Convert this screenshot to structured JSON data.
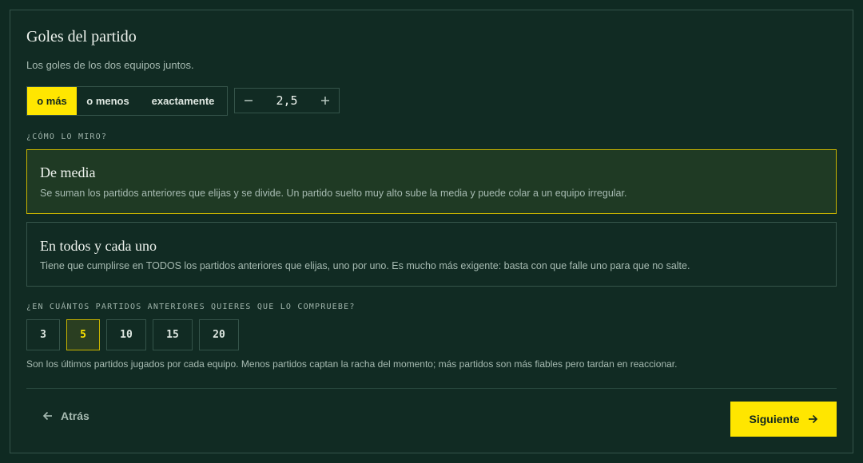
{
  "header": {
    "title": "Goles del partido",
    "subtitle": "Los goles de los dos equipos juntos."
  },
  "mode_toggle": {
    "options": [
      "o más",
      "o menos",
      "exactamente"
    ],
    "selected": "o más"
  },
  "threshold": {
    "value": "2,5",
    "decrement_icon": "minus-icon",
    "increment_icon": "plus-icon"
  },
  "method": {
    "label": "¿Cómo lo miro?",
    "options": [
      {
        "title": "De media",
        "description": "Se suman los partidos anteriores que elijas y se divide. Un partido suelto muy alto sube la media y puede colar a un equipo irregular.",
        "selected": true
      },
      {
        "title": "En todos y cada uno",
        "description": "Tiene que cumplirse en TODOS los partidos anteriores que elijas, uno por uno. Es mucho más exigente: basta con que falle uno para que no salte.",
        "selected": false
      }
    ]
  },
  "matches": {
    "label": "¿En cuántos partidos anteriores quieres que lo compruebe?",
    "options": [
      "3",
      "5",
      "10",
      "15",
      "20"
    ],
    "selected": "5",
    "help": "Son los últimos partidos jugados por cada equipo. Menos partidos captan la racha del momento; más partidos son más fiables pero tardan en reaccionar."
  },
  "footer": {
    "back_label": "Atrás",
    "next_label": "Siguiente",
    "back_icon": "arrow-left-icon",
    "next_icon": "arrow-right-icon"
  },
  "colors": {
    "background": "#112b23",
    "accent": "#ffe600",
    "border": "#35544a"
  }
}
